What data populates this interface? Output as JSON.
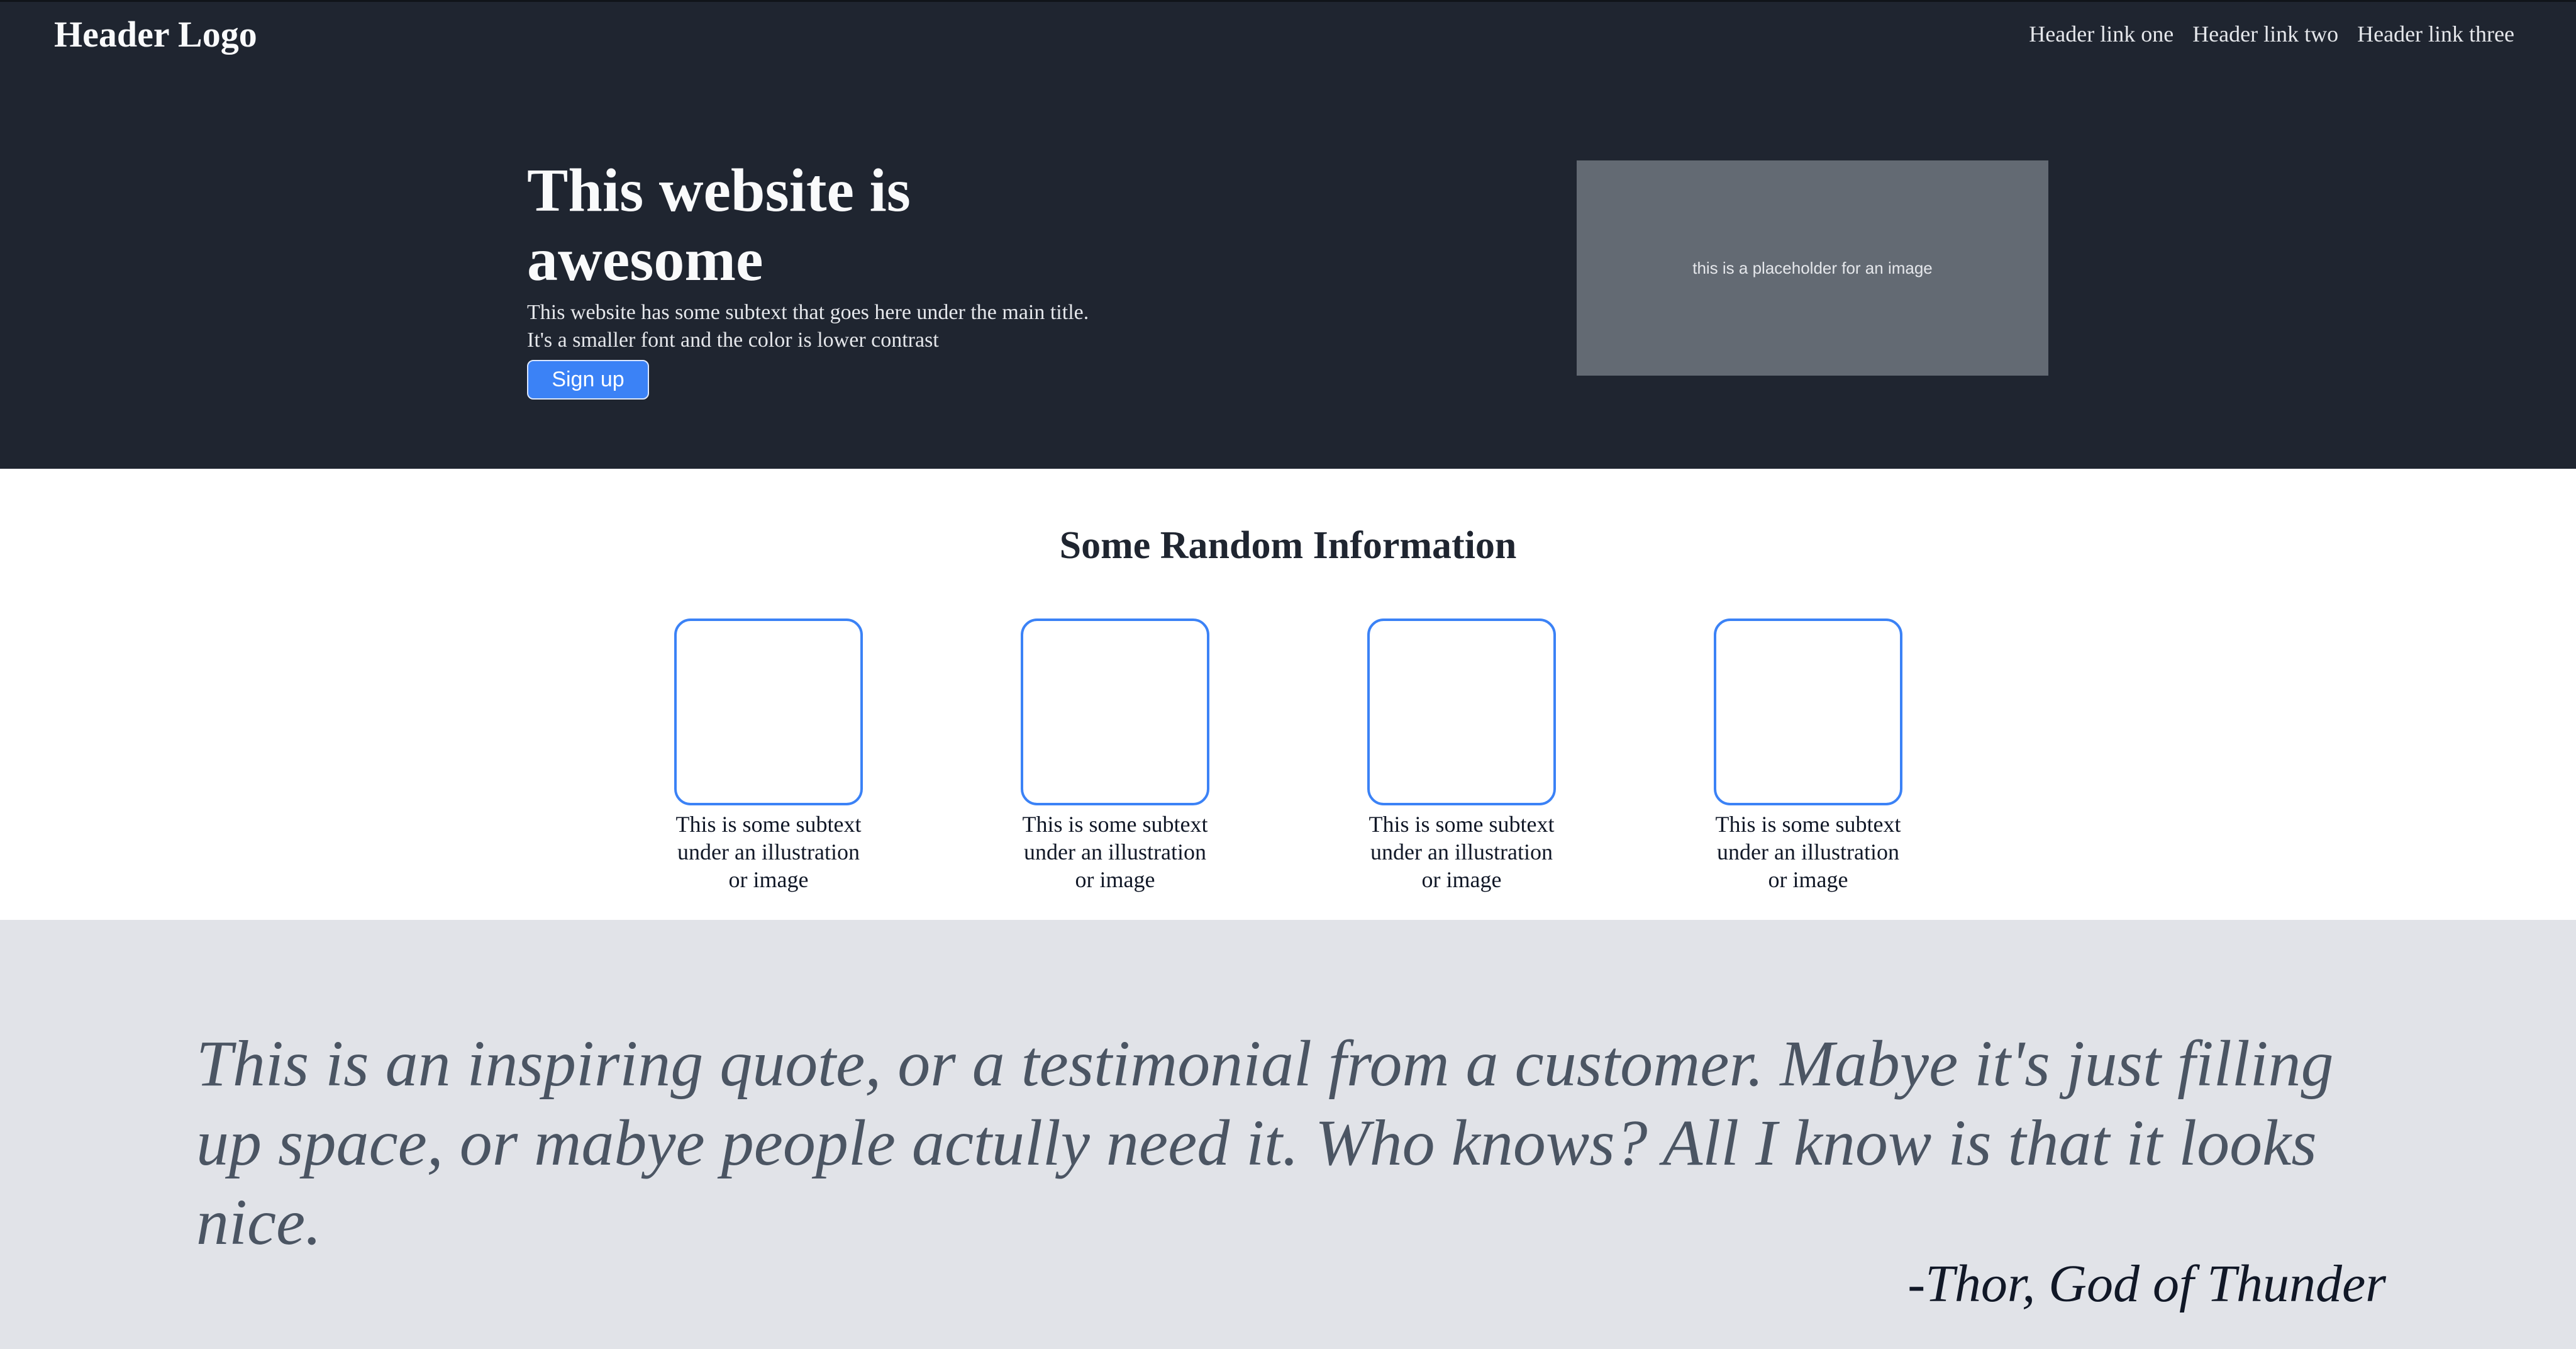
{
  "header": {
    "logo": "Header Logo",
    "links": [
      "Header link one",
      "Header link two",
      "Header link three"
    ]
  },
  "hero": {
    "title": "This website is awesome",
    "subtext": "This website has some subtext that goes here under the main title. It's a smaller font and the color is lower contrast",
    "signup_label": "Sign up",
    "image_placeholder": "this is a placeholder for an image"
  },
  "info": {
    "title": "Some Random Information",
    "cards": [
      {
        "text": "This is some subtext under an illustration or image"
      },
      {
        "text": "This is some subtext under an illustration or image"
      },
      {
        "text": "This is some subtext under an illustration or image"
      },
      {
        "text": "This is some subtext under an illustration or image"
      }
    ]
  },
  "quote": {
    "text": "This is an inspiring quote, or a testimonial from a customer. Mabye it's just filling up space, or mabye people actully need it. Who knows? All I know is that it looks nice.",
    "author": "-Thor, God of Thunder"
  },
  "colors": {
    "dark_bg": "#1f2530",
    "accent": "#3b82f6",
    "quote_bg": "#e1e3e8",
    "placeholder_bg": "#636a73"
  }
}
